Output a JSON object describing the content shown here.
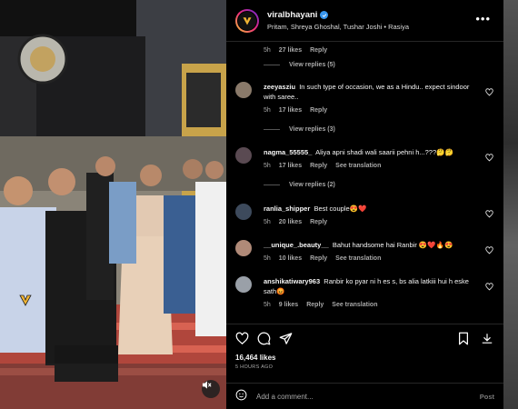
{
  "post": {
    "username": "viralbhayani",
    "subtitle": "Pritam, Shreya Ghoshal, Tushar Joshi • Rasiya",
    "likes": "16,464 likes",
    "time_ago": "5 HOURS AGO"
  },
  "top_partial": {
    "age": "5h",
    "likes": "27 likes",
    "reply": "Reply",
    "view_replies": "View replies (5)"
  },
  "comments": [
    {
      "username": "zeeyasziu",
      "text": "In such type of occasion, we as a Hindu.. expect sindoor with saree..",
      "age": "5h",
      "likes": "17 likes",
      "reply": "Reply",
      "translate": "",
      "view_replies": "View replies (3)",
      "avatar_color": "#8a7a6a"
    },
    {
      "username": "nagma_55555_",
      "text": "Aliya apni shadi wali saarii pehni h...???🤔🤔",
      "age": "5h",
      "likes": "17 likes",
      "reply": "Reply",
      "translate": "See translation",
      "view_replies": "View replies (2)",
      "avatar_color": "#5a4a52"
    },
    {
      "username": "ranlia_shipper",
      "text": "Best couple😍❤️",
      "age": "5h",
      "likes": "20 likes",
      "reply": "Reply",
      "translate": "",
      "view_replies": "",
      "avatar_color": "#3d4a5c"
    },
    {
      "username": "__unique_.beauty__",
      "text": "Bahut handsome hai Ranbir 😍❤️🔥😍",
      "age": "5h",
      "likes": "10 likes",
      "reply": "Reply",
      "translate": "See translation",
      "view_replies": "",
      "avatar_color": "#b08a78"
    },
    {
      "username": "anshikatiwary963",
      "text": "Ranbir ko pyar ni h es s, bs alia latkiii hui h eske sath😡",
      "age": "5h",
      "likes": "9 likes",
      "reply": "Reply",
      "translate": "See translation",
      "view_replies": "",
      "avatar_color": "#9aa0a8"
    }
  ],
  "add_comment": {
    "placeholder": "Add a comment...",
    "post_label": "Post"
  },
  "icons": {
    "like": "heart-icon",
    "comment": "comment-icon",
    "share": "send-icon",
    "save": "bookmark-icon",
    "dm": "download-icon",
    "emoji": "emoji-icon",
    "more": "more-icon",
    "mute": "mute-icon"
  },
  "colors": {
    "panel_bg": "#000000",
    "verified": "#3897f0",
    "muted_text": "#a8a8a8"
  }
}
